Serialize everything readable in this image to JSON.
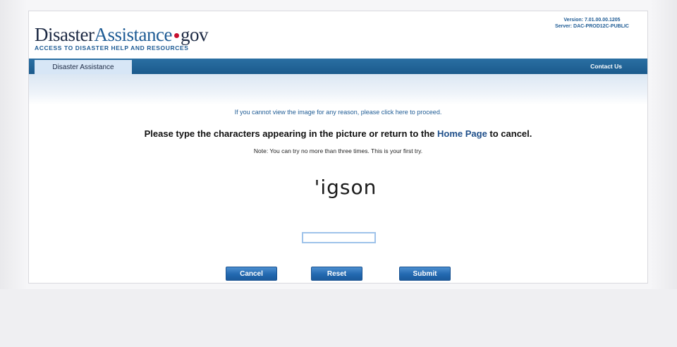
{
  "header": {
    "logo": {
      "part_a": "Disaster",
      "part_b": "Assistance",
      "part_c": "gov"
    },
    "tagline": "ACCESS TO DISASTER HELP AND RESOURCES",
    "version": "Version: 7.01.00.00.1205",
    "server": "Server: DAC-PROD12C-PUBLIC"
  },
  "nav": {
    "tab_label": "Disaster Assistance",
    "contact_label": "Contact Us"
  },
  "main": {
    "cant_view_text": "If you cannot view the image for any reason, please click here to proceed.",
    "instruction_before": "Please type the characters appearing in the picture or return to the ",
    "home_link": "Home Page",
    "instruction_after": " to cancel.",
    "note": "Note: You can try no more than three times. This is your first try.",
    "captcha_text": "'igson",
    "input_value": "",
    "input_placeholder": ""
  },
  "buttons": {
    "cancel": "Cancel",
    "reset": "Reset",
    "submit": "Submit"
  },
  "colors": {
    "brand_blue": "#1f5c95",
    "nav_bar": "#1b5a8c",
    "logo_dot": "#c8102e",
    "button_blue": "#2369b0"
  }
}
